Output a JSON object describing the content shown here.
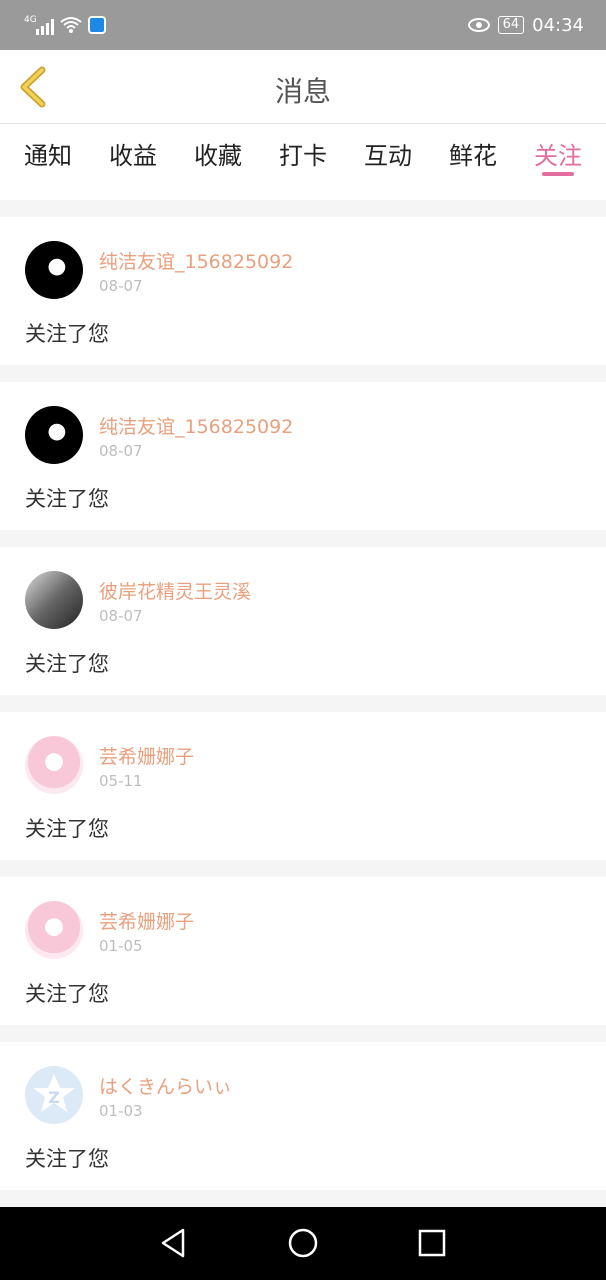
{
  "status_bar": {
    "network": "4G",
    "battery": "64",
    "time": "04:34"
  },
  "header": {
    "title": "消息",
    "back_icon": "chevron-left-icon"
  },
  "tabs": [
    {
      "label": "通知",
      "active": false
    },
    {
      "label": "收益",
      "active": false
    },
    {
      "label": "收藏",
      "active": false
    },
    {
      "label": "打卡",
      "active": false
    },
    {
      "label": "互动",
      "active": false
    },
    {
      "label": "鲜花",
      "active": false
    },
    {
      "label": "关注",
      "active": true
    }
  ],
  "accent_color": "#e46d9f",
  "username_color": "#e9a07e",
  "items": [
    {
      "username": "纯洁友谊_156825092",
      "date": "08-07",
      "message": "关注了您",
      "avatar": "dark"
    },
    {
      "username": "纯洁友谊_156825092",
      "date": "08-07",
      "message": "关注了您",
      "avatar": "dark"
    },
    {
      "username": "彼岸花精灵王灵溪",
      "date": "08-07",
      "message": "关注了您",
      "avatar": "photo"
    },
    {
      "username": "芸希姗娜子",
      "date": "05-11",
      "message": "关注了您",
      "avatar": "anime"
    },
    {
      "username": "芸希姗娜子",
      "date": "01-05",
      "message": "关注了您",
      "avatar": "anime"
    },
    {
      "username": "はくきんらいぃ",
      "date": "01-03",
      "message": "关注了您",
      "avatar": "qq"
    }
  ]
}
